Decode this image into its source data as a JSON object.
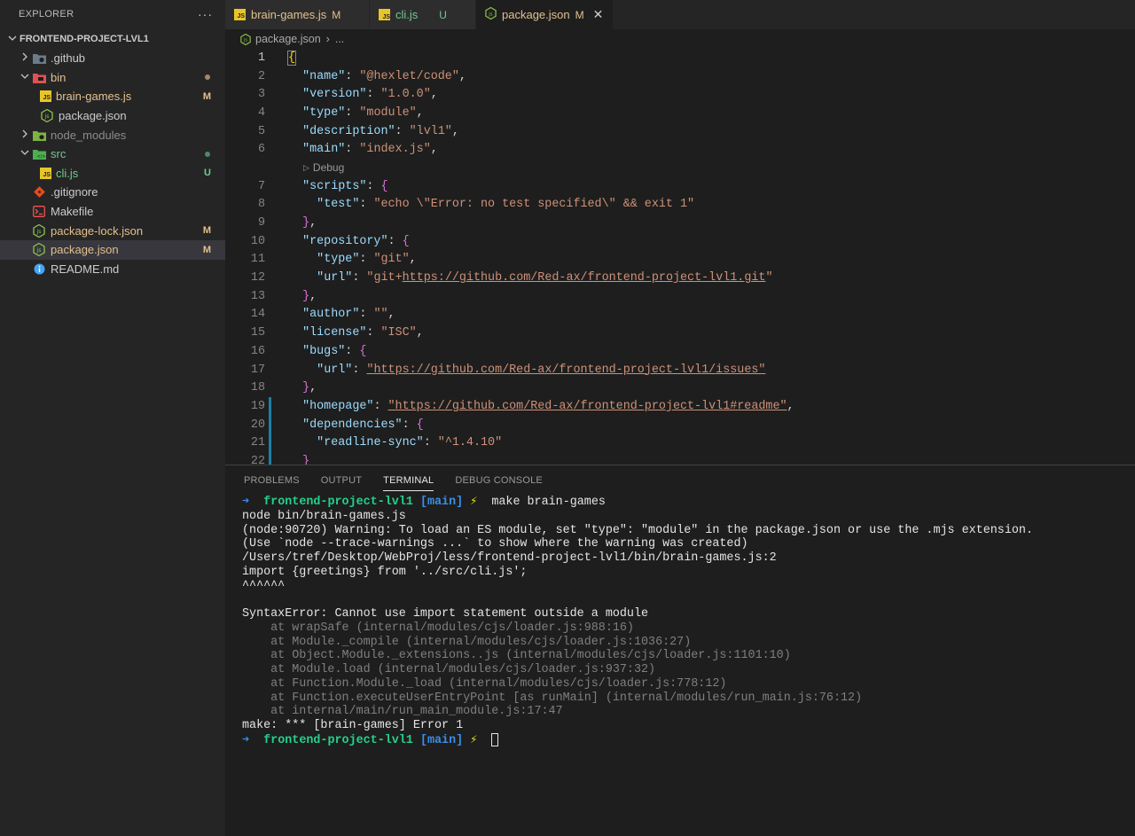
{
  "explorer": {
    "title": "EXPLORER",
    "more": "···",
    "project": "FRONTEND-PROJECT-LVL1",
    "items": [
      {
        "label": ".github",
        "status": ""
      },
      {
        "label": "bin",
        "status": ""
      },
      {
        "label": "brain-games.js",
        "status": "M"
      },
      {
        "label": "package.json",
        "status": ""
      },
      {
        "label": "node_modules",
        "status": ""
      },
      {
        "label": "src",
        "status": ""
      },
      {
        "label": "cli.js",
        "status": "U"
      },
      {
        "label": ".gitignore",
        "status": ""
      },
      {
        "label": "Makefile",
        "status": ""
      },
      {
        "label": "package-lock.json",
        "status": "M"
      },
      {
        "label": "package.json",
        "status": "M"
      },
      {
        "label": "README.md",
        "status": ""
      }
    ]
  },
  "tabs": [
    {
      "label": "brain-games.js",
      "status": "M",
      "icon": "JS"
    },
    {
      "label": "cli.js",
      "status": "U",
      "icon": "JS"
    },
    {
      "label": "package.json",
      "status": "M",
      "close": "✕"
    }
  ],
  "breadcrumb": {
    "file": "package.json",
    "sep": "›",
    "more": "..."
  },
  "editor": {
    "line_numbers": [
      "1",
      "2",
      "3",
      "4",
      "5",
      "6",
      "7",
      "8",
      "9",
      "10",
      "11",
      "12",
      "13",
      "14",
      "15",
      "16",
      "17",
      "18",
      "19",
      "20",
      "21",
      "22"
    ],
    "codelens": "Debug",
    "lines": {
      "l1": "{",
      "l2k": "\"name\"",
      "l2v": "\"@hexlet/code\"",
      "l3k": "\"version\"",
      "l3v": "\"1.0.0\"",
      "l4k": "\"type\"",
      "l4v": "\"module\"",
      "l5k": "\"description\"",
      "l5v": "\"lvl1\"",
      "l6k": "\"main\"",
      "l6v": "\"index.js\"",
      "l7k": "\"scripts\"",
      "l8k": "\"test\"",
      "l8v": "\"echo \\\"Error: no test specified\\\" && exit 1\"",
      "l10k": "\"repository\"",
      "l11k": "\"type\"",
      "l11v": "\"git\"",
      "l12k": "\"url\"",
      "l12q": "\"",
      "l12a": "git+",
      "l12u": "https://github.com/Red-ax/frontend-project-lvl1.git",
      "l12e": "\"",
      "l14k": "\"author\"",
      "l14v": "\"\"",
      "l15k": "\"license\"",
      "l15v": "\"ISC\"",
      "l16k": "\"bugs\"",
      "l17k": "\"url\"",
      "l17u": "\"https://github.com/Red-ax/frontend-project-lvl1/issues\"",
      "l19k": "\"homepage\"",
      "l19u": "\"https://github.com/Red-ax/frontend-project-lvl1#readme\"",
      "l20k": "\"dependencies\"",
      "l21k": "\"readline-sync\"",
      "l21v": "\"^1.4.10\"",
      "l22": "}"
    }
  },
  "panel": {
    "tabs": [
      "PROBLEMS",
      "OUTPUT",
      "TERMINAL",
      "DEBUG CONSOLE"
    ],
    "active_tab": "TERMINAL"
  },
  "terminal": {
    "prompt_arrow": "➜",
    "prompt_dir": "frontend-project-lvl1",
    "prompt_branch": "[main]",
    "prompt_bolt": "⚡",
    "command": "make brain-games",
    "output": [
      "node bin/brain-games.js",
      "(node:90720) Warning: To load an ES module, set \"type\": \"module\" in the package.json or use the .mjs extension.",
      "(Use `node --trace-warnings ...` to show where the warning was created)",
      "/Users/tref/Desktop/WebProj/less/frontend-project-lvl1/bin/brain-games.js:2",
      "import {greetings} from '../src/cli.js';",
      "^^^^^^",
      "",
      "SyntaxError: Cannot use import statement outside a module"
    ],
    "stack": [
      "    at wrapSafe (internal/modules/cjs/loader.js:988:16)",
      "    at Module._compile (internal/modules/cjs/loader.js:1036:27)",
      "    at Object.Module._extensions..js (internal/modules/cjs/loader.js:1101:10)",
      "    at Module.load (internal/modules/cjs/loader.js:937:32)",
      "    at Function.Module._load (internal/modules/cjs/loader.js:778:12)",
      "    at Function.executeUserEntryPoint [as runMain] (internal/modules/run_main.js:76:12)",
      "    at internal/main/run_main_module.js:17:47"
    ],
    "error_line": "make: *** [brain-games] Error 1"
  },
  "colors": {
    "modified": "#e2c08d",
    "untracked": "#73c991",
    "json_key": "#9cdcfe",
    "json_string": "#ce9178"
  }
}
